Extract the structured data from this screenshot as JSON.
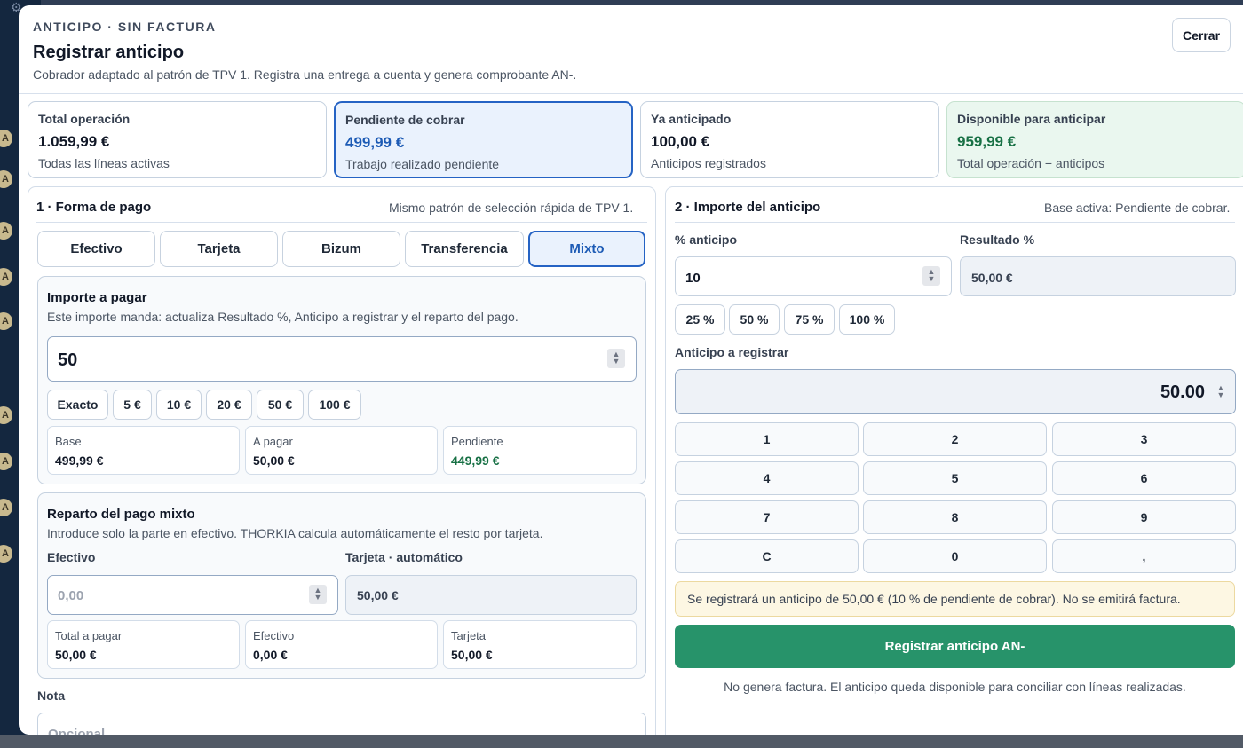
{
  "header": {
    "eyebrow": "ANTICIPO · SIN FACTURA",
    "title": "Registrar anticipo",
    "subtitle": "Cobrador adaptado al patrón de TPV 1. Registra una entrega a cuenta y genera comprobante AN-.",
    "close_label": "Cerrar"
  },
  "summary": [
    {
      "label": "Total operación",
      "value": "1.059,99 €",
      "sub": "Todas las líneas activas"
    },
    {
      "label": "Pendiente de cobrar",
      "value": "499,99 €",
      "sub": "Trabajo realizado pendiente"
    },
    {
      "label": "Ya anticipado",
      "value": "100,00 €",
      "sub": "Anticipos registrados"
    },
    {
      "label": "Disponible para anticipar",
      "value": "959,99 €",
      "sub": "Total operación − anticipos"
    }
  ],
  "payment": {
    "title": "1 · Forma de pago",
    "note": "Mismo patrón de selección rápida de TPV 1.",
    "methods": [
      "Efectivo",
      "Tarjeta",
      "Bizum",
      "Transferencia",
      "Mixto"
    ],
    "selected": "Mixto",
    "amount": {
      "title": "Importe a pagar",
      "note": "Este importe manda: actualiza Resultado %, Anticipo a registrar y el reparto del pago.",
      "value": "50",
      "quick": [
        "Exacto",
        "5 €",
        "10 €",
        "20 €",
        "50 €",
        "100 €"
      ],
      "stats": [
        {
          "label": "Base",
          "value": "499,99 €"
        },
        {
          "label": "A pagar",
          "value": "50,00 €"
        },
        {
          "label": "Pendiente",
          "value": "449,99 €"
        }
      ]
    },
    "mixed": {
      "title": "Reparto del pago mixto",
      "note": "Introduce solo la parte en efectivo. THORKIA calcula automáticamente el resto por tarjeta.",
      "cash_label": "Efectivo",
      "cash_placeholder": "0,00",
      "card_label": "Tarjeta · automático",
      "card_value": "50,00 €",
      "stats": [
        {
          "label": "Total a pagar",
          "value": "50,00 €"
        },
        {
          "label": "Efectivo",
          "value": "0,00 €"
        },
        {
          "label": "Tarjeta",
          "value": "50,00 €"
        }
      ]
    },
    "note_label": "Nota",
    "note_placeholder": "Opcional"
  },
  "advance": {
    "title": "2 · Importe del anticipo",
    "note": "Base activa: Pendiente de cobrar.",
    "pct_label": "% anticipo",
    "pct_value": "10",
    "result_label": "Resultado %",
    "result_value": "50,00 €",
    "pct_chips": [
      "25 %",
      "50 %",
      "75 %",
      "100 %"
    ],
    "amount_label": "Anticipo a registrar",
    "amount_value": "50.00",
    "keypad": [
      "1",
      "2",
      "3",
      "4",
      "5",
      "6",
      "7",
      "8",
      "9",
      "C",
      "0",
      ","
    ],
    "notice": "Se registrará un anticipo de 50,00 € (10 % de pendiente de cobrar). No se emitirá factura.",
    "submit_label": "Registrar anticipo AN-",
    "footer": "No genera factura. El anticipo queda disponible para conciliar con líneas realizadas."
  },
  "colors": {
    "accent": "#2563c4",
    "success": "#27936a",
    "positive_text": "#177044",
    "notice_bg": "#fdf7e3"
  }
}
